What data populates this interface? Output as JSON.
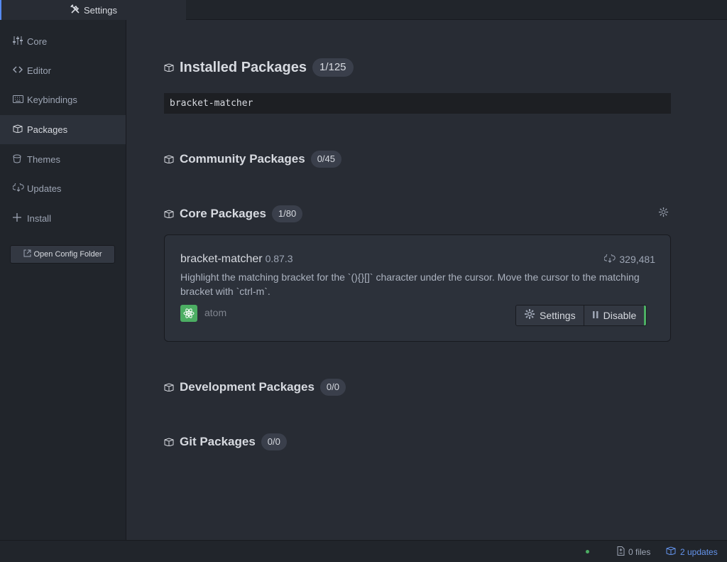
{
  "tab": {
    "title": "Settings",
    "icon": "tools-icon"
  },
  "sidebar": {
    "items": [
      {
        "label": "Core",
        "icon": "sliders-icon"
      },
      {
        "label": "Editor",
        "icon": "code-icon"
      },
      {
        "label": "Keybindings",
        "icon": "keyboard-icon"
      },
      {
        "label": "Packages",
        "icon": "package-icon",
        "active": true
      },
      {
        "label": "Themes",
        "icon": "paintcan-icon"
      },
      {
        "label": "Updates",
        "icon": "cloud-download-icon"
      },
      {
        "label": "Install",
        "icon": "plus-icon"
      }
    ],
    "config_button": "Open Config Folder"
  },
  "main": {
    "installed": {
      "title": "Installed Packages",
      "count": "1/125"
    },
    "search": {
      "value": "bracket-matcher"
    },
    "community": {
      "title": "Community Packages",
      "count": "0/45"
    },
    "core": {
      "title": "Core Packages",
      "count": "1/80"
    },
    "package": {
      "name": "bracket-matcher",
      "version": "0.87.3",
      "downloads": "329,481",
      "description": "Highlight the matching bracket for the `(){}[]` character under the cursor. Move the cursor to the matching bracket with `ctrl-m`.",
      "author": "atom",
      "settings_label": "Settings",
      "disable_label": "Disable"
    },
    "development": {
      "title": "Development Packages",
      "count": "0/0"
    },
    "git": {
      "title": "Git Packages",
      "count": "0/0"
    }
  },
  "statusbar": {
    "files": "0 files",
    "updates": "2 updates"
  },
  "colors": {
    "accent": "#568af2",
    "enabled": "#4cae63",
    "updates_link": "#6494ed"
  }
}
